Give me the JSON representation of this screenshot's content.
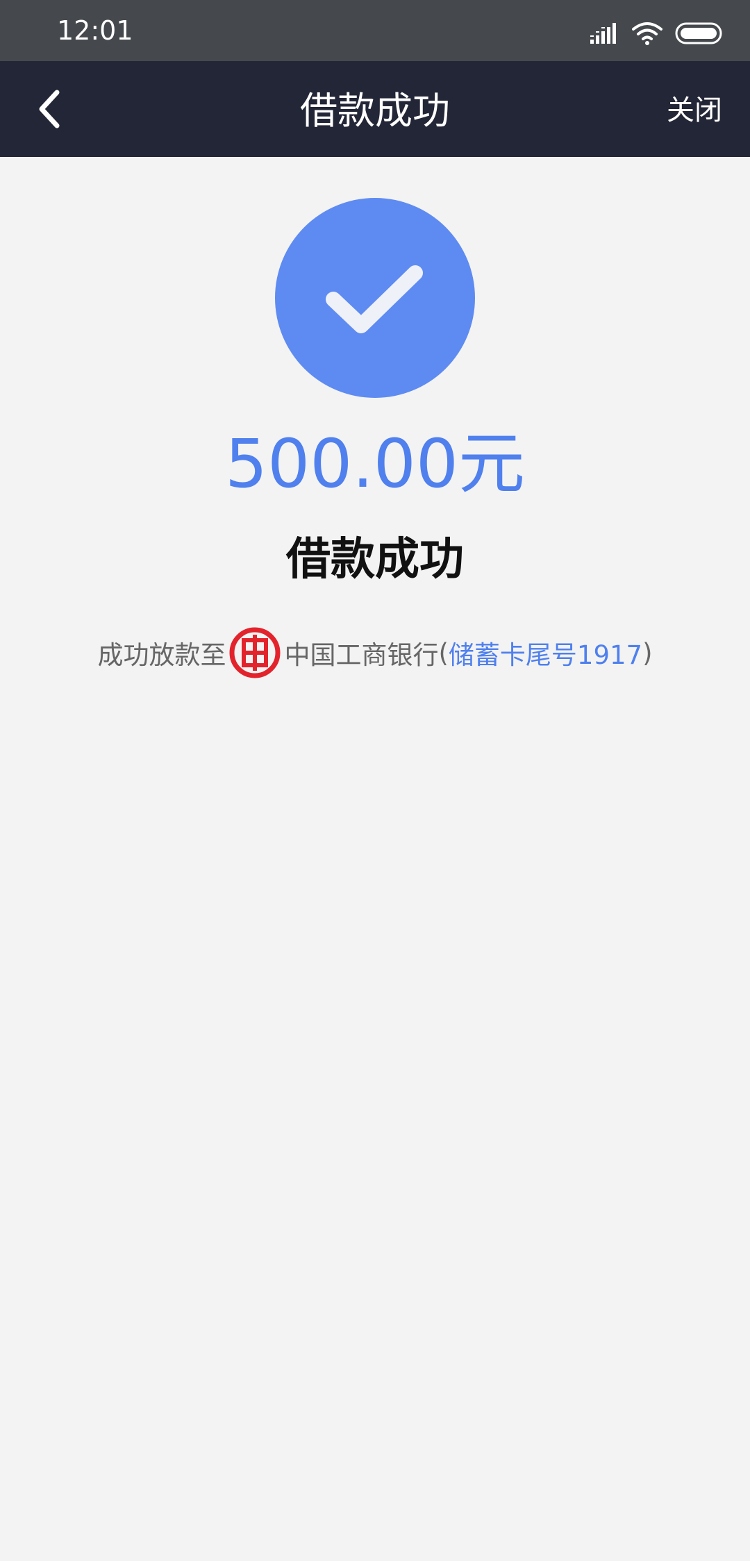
{
  "status_bar": {
    "time": "12:01"
  },
  "nav": {
    "title": "借款成功",
    "close_label": "关闭"
  },
  "result": {
    "amount": "500.00元",
    "status_text": "借款成功"
  },
  "disbursement": {
    "prefix": "成功放款至",
    "bank_name": "中国工商银行",
    "paren_open": "(",
    "card_info": "储蓄卡尾号1917",
    "paren_close": ")"
  },
  "colors": {
    "status_bar_bg": "#45494e",
    "nav_bg": "#232636",
    "page_bg": "#f3f3f3",
    "accent": "#4f80ee",
    "success_circle": "#5e8bf2",
    "bank_logo_red": "#e3232c"
  },
  "icons": {
    "back": "chevron-left-icon",
    "success": "checkmark-icon",
    "bank": "icbc-logo-icon",
    "signal": "signal-icon",
    "wifi": "wifi-icon",
    "battery": "battery-icon"
  }
}
